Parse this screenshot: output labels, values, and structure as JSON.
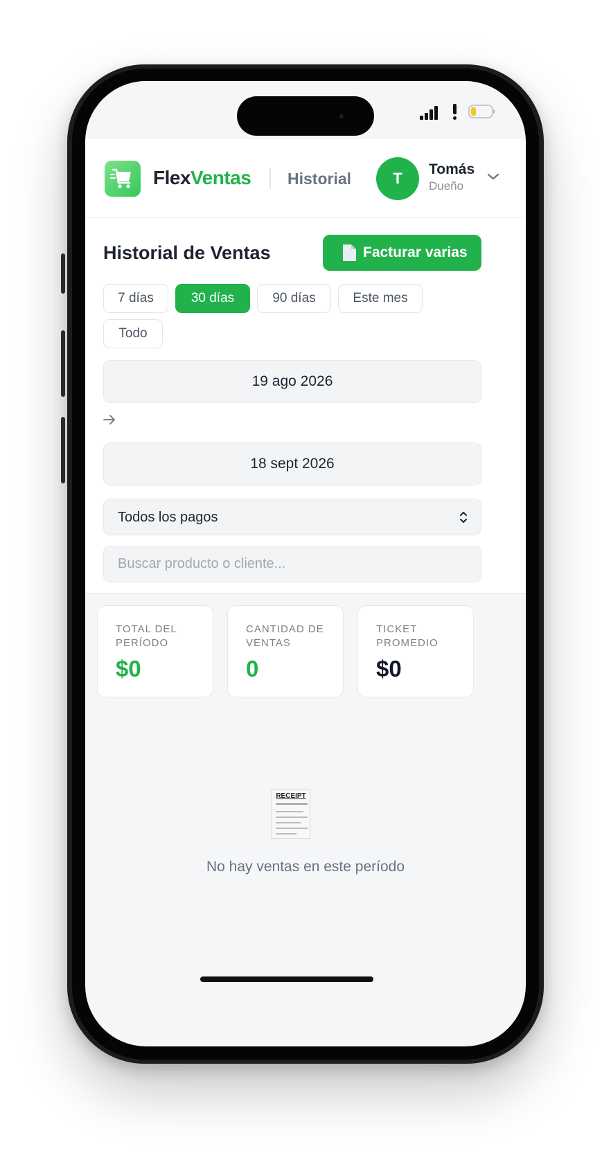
{
  "app": {
    "brand_part1": "Flex",
    "brand_part2": "Ventas",
    "current_section": "Historial",
    "user_initial": "T",
    "user_name": "Tomás",
    "user_role": "Dueño"
  },
  "page": {
    "title": "Historial de Ventas",
    "bulk_invoice_label": "Facturar varias"
  },
  "ranges": {
    "options": [
      "7 días",
      "30 días",
      "90 días",
      "Este mes",
      "Todo"
    ],
    "selected": "30 días"
  },
  "dates": {
    "from": "19 ago 2026",
    "to": "18 sept 2026"
  },
  "payment_filter": {
    "selected": "Todos los pagos"
  },
  "search": {
    "placeholder": "Buscar producto o cliente...",
    "value": ""
  },
  "stats": [
    {
      "label": "TOTAL DEL PERÍODO",
      "value": "$0"
    },
    {
      "label": "CANTIDAD DE VENTAS",
      "value": "0"
    },
    {
      "label": "TICKET PROMEDIO",
      "value": "$0"
    }
  ],
  "empty_state": {
    "image_text": "RECEIPT",
    "message": "No hay ventas en este período"
  },
  "icons": [
    "cart-logo-icon",
    "chevron-down-icon",
    "document-icon",
    "arrow-right-icon",
    "up-down-chevron-icon",
    "receipt-icon",
    "signal-icon",
    "alert-icon",
    "battery-icon"
  ],
  "colors": {
    "accent": "#22b24c",
    "text_dark": "#1d2330",
    "muted": "#6b7280",
    "background": "#f5f6f8"
  },
  "device": {
    "battery_fraction": 0.25
  }
}
